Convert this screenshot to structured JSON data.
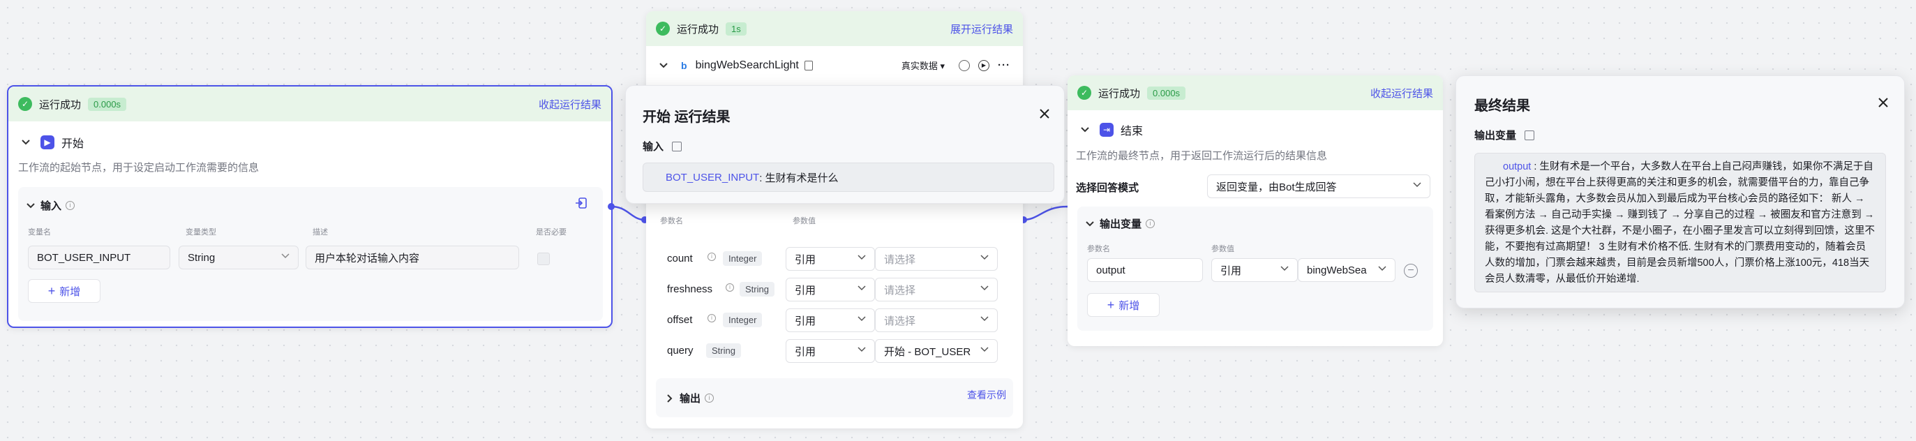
{
  "start_node": {
    "status": "运行成功",
    "time": "0.000s",
    "collapse_link": "收起运行结果",
    "title": "开始",
    "desc": "工作流的起始节点，用于设定启动工作流需要的信息",
    "input_section": "输入",
    "col_name": "变量名",
    "col_type": "变量类型",
    "col_desc": "描述",
    "col_required": "是否必要",
    "var_name": "BOT_USER_INPUT",
    "var_type": "String",
    "var_desc": "用户本轮对话输入内容",
    "add_button": "新增"
  },
  "start_result": {
    "title": "开始 运行结果",
    "input_label": "输入",
    "value_key": "BOT_USER_INPUT",
    "value_text": ": 生财有术是什么"
  },
  "plugin_node": {
    "status": "运行成功",
    "time": "1s",
    "expand_link": "展开运行结果",
    "title": "bingWebSearchLight",
    "data_mode": "真实数据",
    "col_name": "参数名",
    "col_value": "参数值",
    "params": [
      {
        "name": "count",
        "type": "Integer",
        "mode": "引用",
        "value": "请选择"
      },
      {
        "name": "freshness",
        "type": "String",
        "mode": "引用",
        "value": "请选择"
      },
      {
        "name": "offset",
        "type": "Integer",
        "mode": "引用",
        "value": "请选择"
      },
      {
        "name": "query",
        "type": "String",
        "mode": "引用",
        "value": "开始 - BOT_USER"
      }
    ],
    "output_section": "输出",
    "example_link": "查看示例"
  },
  "end_node": {
    "status": "运行成功",
    "time": "0.000s",
    "collapse_link": "收起运行结果",
    "title": "结束",
    "desc": "工作流的最终节点，用于返回工作流运行后的结果信息",
    "mode_label": "选择回答模式",
    "mode_value": "返回变量，由Bot生成回答",
    "output_section": "输出变量",
    "col_name": "参数名",
    "col_value": "参数值",
    "var_name": "output",
    "var_mode": "引用",
    "var_ref": "bingWebSea",
    "add_button": "新增"
  },
  "final_result": {
    "title": "最终结果",
    "output_label": "输出变量",
    "key": "output",
    "text": " : 生财有术是一个平台，大多数人在平台上自己闷声赚钱，如果你不满足于自己小打小闹，想在平台上获得更高的关注和更多的机会，就需要借平台的力，靠自己争取，才能斩头露角，大多数会员从加入到最后成为平台核心会员的路径如下： 新人 → 看案例方法 → 自己动手实操 → 赚到钱了 → 分享自己的过程 → 被圈友和官方注意到 → 获得更多机会. 这是个大社群，不是小圈子，在小圈子里发言可以立刻得到回馈，这里不能，不要抱有过高期望！ 3 生财有术价格不低. 生财有术的门票费用变动的，随着会员人数的增加，门票会越来越贵，目前是会员新增500人，门票价格上涨100元，418当天会员人数清零，从最低价开始递增."
  },
  "colors": {
    "accent": "#4d53e8",
    "success": "#3dbb5e",
    "success_bg": "#e8f5e9"
  }
}
